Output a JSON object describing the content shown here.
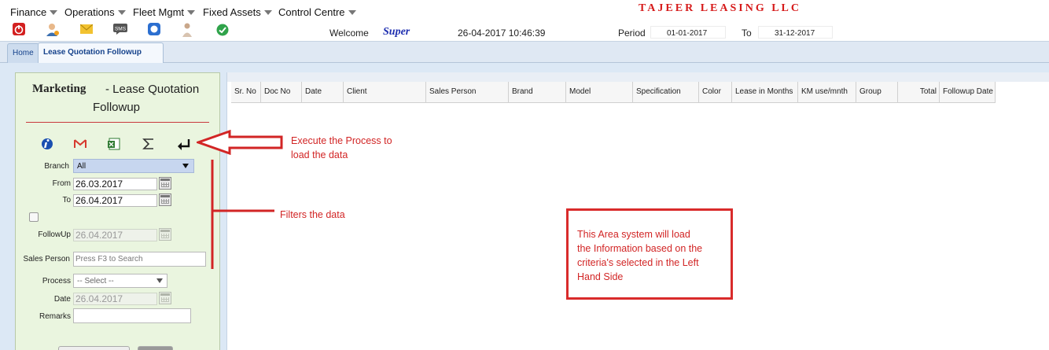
{
  "menu": {
    "items": [
      {
        "label": "Finance"
      },
      {
        "label": "Operations"
      },
      {
        "label": "Fleet Mgmt"
      },
      {
        "label": "Fixed Assets"
      },
      {
        "label": "Control Centre"
      }
    ],
    "company": "TAJEER LEASING LLC"
  },
  "toolbar": {
    "icons": [
      "power-icon",
      "user-settings-icon",
      "mail-icon",
      "sms-icon",
      "chat-icon",
      "person-icon",
      "check-icon"
    ],
    "sms_text": "SMS",
    "welcome": "Welcome",
    "user": "Super",
    "datetime": "26-04-2017 10:46:39",
    "period_label": "Period",
    "period_from": "01-01-2017",
    "to_label": "To",
    "period_to": "31-12-2017"
  },
  "tabs": [
    {
      "label": "Home"
    },
    {
      "label": "Lease Quotation Followup"
    }
  ],
  "panel": {
    "title_bold": "Marketing",
    "title_rest": "- Lease Quotation",
    "title_line2": "Followup",
    "actions": [
      "info-icon",
      "gmail-icon",
      "excel-icon",
      "sum-icon",
      "execute-icon"
    ],
    "branch_label": "Branch",
    "branch_value": "All",
    "from_label": "From",
    "from_value": "26.03.2017",
    "to_label": "To",
    "to_value": "26.04.2017",
    "followup_label": "FollowUp",
    "followup_value": "26.04.2017",
    "salesperson_label": "Sales Person",
    "salesperson_placeholder": "Press F3 to Search",
    "process_label": "Process",
    "process_value": "-- Select --",
    "date_label": "Date",
    "date_value": "26.04.2017",
    "remarks_label": "Remarks",
    "remarks_value": ""
  },
  "grid": {
    "columns": [
      "Sr. No",
      "Doc No",
      "Date",
      "Client",
      "Sales Person",
      "Brand",
      "Model",
      "Specification",
      "Color",
      "Lease in Months",
      "KM use/mnth",
      "Group",
      "Total",
      "Followup Date"
    ]
  },
  "annotations": {
    "execute_line1": "Execute the Process to",
    "execute_line2": "load the data",
    "filters": "Filters the data",
    "area_line1": "This Area system will load",
    "area_line2": "the Information based on the",
    "area_line3": "criteria's selected in the Left",
    "area_line4": "Hand Side"
  },
  "colors": {
    "accent_red": "#d22525",
    "company_red": "#d61a1a",
    "panel_green": "#eaf5df",
    "tab_blue": "#15428b"
  }
}
